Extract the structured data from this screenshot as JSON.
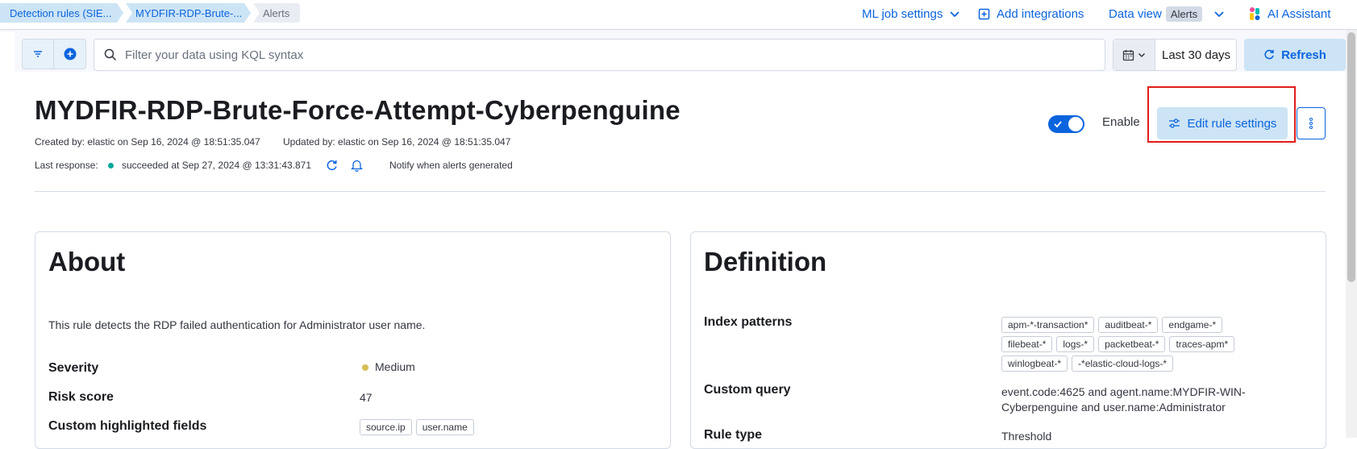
{
  "breadcrumbs": [
    "Detection rules (SIE...",
    "MYDFIR-RDP-Brute-...",
    "Alerts"
  ],
  "header": {
    "ml_job_settings": "ML job settings",
    "add_integrations": "Add integrations",
    "data_view_label": "Data view",
    "data_view_value": "Alerts",
    "ai_assistant": "AI Assistant"
  },
  "filter": {
    "placeholder": "Filter your data using KQL syntax",
    "date_range": "Last 30 days",
    "refresh": "Refresh"
  },
  "rule": {
    "title": "MYDFIR-RDP-Brute-Force-Attempt-Cyberpenguine",
    "created": "Created by: elastic on Sep 16, 2024 @ 18:51:35.047",
    "updated": "Updated by: elastic on Sep 16, 2024 @ 18:51:35.047",
    "last_response_label": "Last response:",
    "last_response_value": "succeeded at Sep 27, 2024 @ 13:31:43.871",
    "notify": "Notify when alerts generated",
    "enable_label": "Enable",
    "enabled": true,
    "edit_button": "Edit rule settings"
  },
  "about": {
    "heading": "About",
    "description": "This rule detects the RDP failed authentication for Administrator user name.",
    "severity_label": "Severity",
    "severity_value": "Medium",
    "risk_label": "Risk score",
    "risk_value": "47",
    "fields_label": "Custom highlighted fields",
    "fields": [
      "source.ip",
      "user.name"
    ]
  },
  "definition": {
    "heading": "Definition",
    "index_label": "Index patterns",
    "index_rows": [
      [
        "apm-*-transaction*",
        "auditbeat-*",
        "endgame-*"
      ],
      [
        "filebeat-*",
        "logs-*",
        "packetbeat-*",
        "traces-apm*"
      ],
      [
        "winlogbeat-*",
        "-*elastic-cloud-logs-*"
      ]
    ],
    "query_label": "Custom query",
    "query_line1": "event.code:4625 and agent.name:MYDFIR-WIN-",
    "query_line2": "Cyberpenguine and user.name:Administrator",
    "rule_type_label": "Rule type",
    "rule_type_value": "Threshold"
  },
  "colors": {
    "primary": "#0b64dd",
    "success": "#00a69b",
    "warning": "#d6bf57",
    "highlight": "#e21b1b"
  }
}
